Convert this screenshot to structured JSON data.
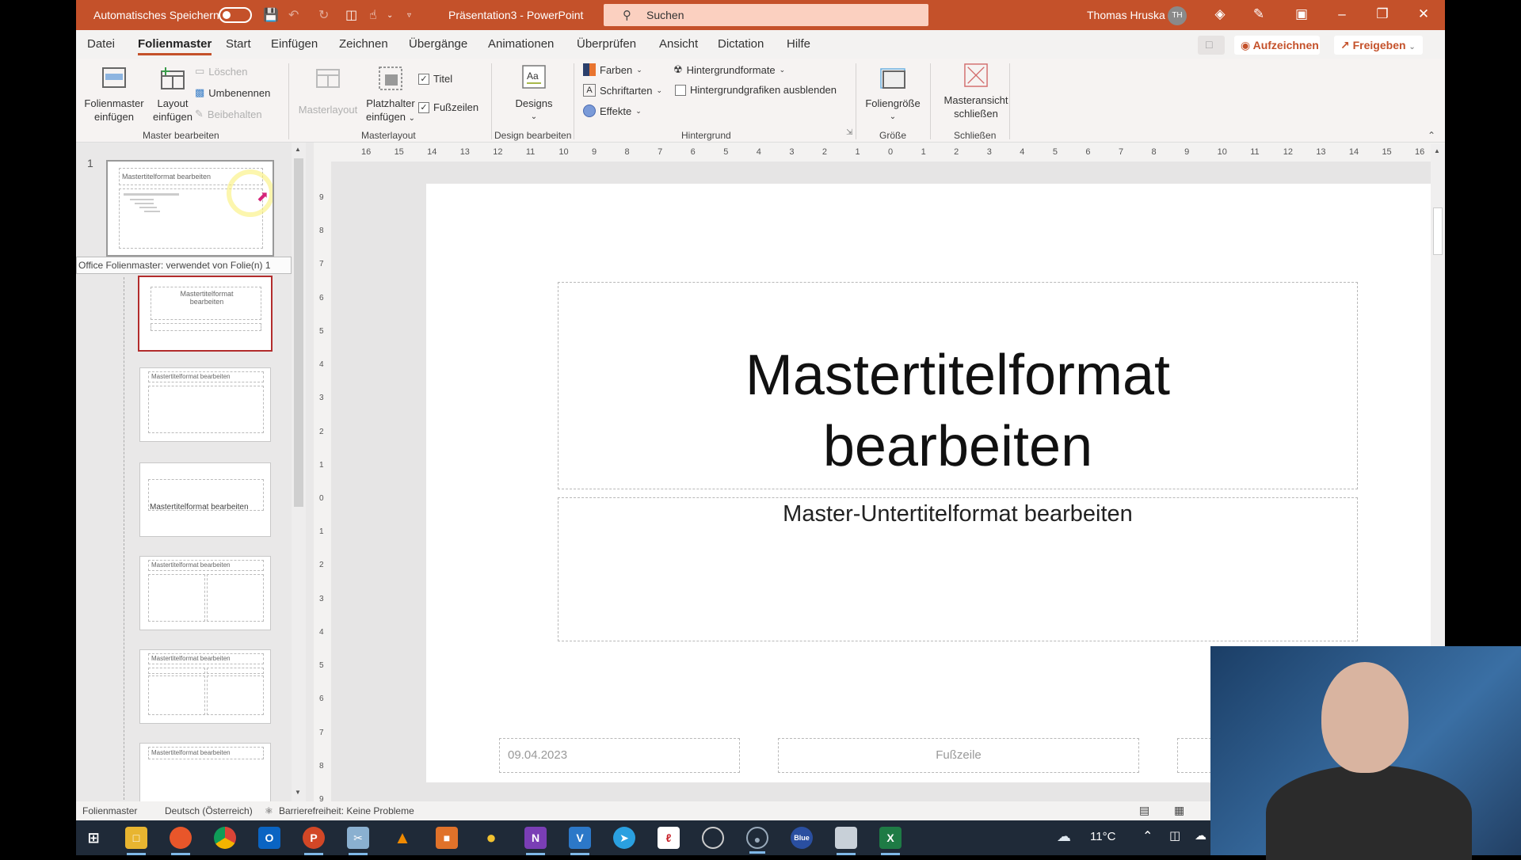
{
  "titlebar": {
    "autosave_label": "Automatisches Speichern",
    "doc_title": "Präsentation3  -  PowerPoint",
    "search_placeholder": "Suchen",
    "user_name": "Thomas Hruska",
    "user_initials": "TH"
  },
  "menu": {
    "tabs": [
      "Datei",
      "Folienmaster",
      "Start",
      "Einfügen",
      "Zeichnen",
      "Übergänge",
      "Animationen",
      "Überprüfen",
      "Ansicht",
      "Dictation",
      "Hilfe"
    ],
    "active": "Folienmaster",
    "record_label": "Aufzeichnen",
    "share_label": "Freigeben"
  },
  "ribbon": {
    "master_bearbeiten": {
      "label": "Master bearbeiten",
      "insert_master": [
        "Folienmaster",
        "einfügen"
      ],
      "insert_layout": [
        "Layout",
        "einfügen"
      ],
      "delete": "Löschen",
      "rename": "Umbenennen",
      "preserve": "Beibehalten"
    },
    "masterlayout": {
      "label": "Masterlayout",
      "masterlayout": "Masterlayout",
      "placeholder": [
        "Platzhalter",
        "einfügen"
      ],
      "title_check": "Titel",
      "title_checked": true,
      "footer_check": "Fußzeilen",
      "footer_checked": true
    },
    "design": {
      "label": "Design bearbeiten",
      "designs": "Designs"
    },
    "hintergrund": {
      "label": "Hintergrund",
      "colors": "Farben",
      "fonts": "Schriftarten",
      "effects": "Effekte",
      "bg_formats": "Hintergrundformate",
      "hide_bg": "Hintergrundgrafiken ausblenden",
      "hide_bg_checked": false
    },
    "groesse": {
      "label": "Größe",
      "slide_size": "Foliengröße"
    },
    "schliessen": {
      "label": "Schließen",
      "close_master": [
        "Masteransicht",
        "schließen"
      ]
    }
  },
  "thumbnails": {
    "master_number": "1",
    "tooltip": "Office Folienmaster: verwendet von Folie(n) 1",
    "master_title": "Mastertitelformat bearbeiten",
    "layouts": [
      {
        "title": "Mastertitelformat bearbeiten",
        "type": "title",
        "selected": true
      },
      {
        "title": "Mastertitelformat bearbeiten",
        "type": "content",
        "selected": false
      },
      {
        "title": "Mastertitelformat bearbeiten",
        "type": "section",
        "selected": false
      },
      {
        "title": "Mastertitelformat bearbeiten",
        "type": "two-content",
        "selected": false
      },
      {
        "title": "Mastertitelformat bearbeiten",
        "type": "comparison",
        "selected": false
      },
      {
        "title": "Mastertitelformat bearbeiten",
        "type": "title-only",
        "selected": false
      }
    ]
  },
  "ruler": {
    "h_ticks": [
      "16",
      "15",
      "14",
      "13",
      "12",
      "11",
      "10",
      "9",
      "8",
      "7",
      "6",
      "5",
      "4",
      "3",
      "2",
      "1",
      "0",
      "1",
      "2",
      "3",
      "4",
      "5",
      "6",
      "7",
      "8",
      "9",
      "10",
      "11",
      "12",
      "13",
      "14",
      "15",
      "16"
    ],
    "v_ticks": [
      "9",
      "8",
      "7",
      "6",
      "5",
      "4",
      "3",
      "2",
      "1",
      "0",
      "1",
      "2",
      "3",
      "4",
      "5",
      "6",
      "7",
      "8",
      "9"
    ]
  },
  "slide": {
    "title_line1": "Mastertitelformat",
    "title_line2": "bearbeiten",
    "subtitle": "Master-Untertitelformat bearbeiten",
    "date": "09.04.2023",
    "footer": "Fußzeile"
  },
  "status": {
    "view": "Folienmaster",
    "language": "Deutsch (Österreich)",
    "accessibility": "Barrierefreiheit: Keine Probleme"
  },
  "taskbar": {
    "apps": [
      "windows-start",
      "file-explorer",
      "firefox",
      "chrome",
      "outlook",
      "powerpoint",
      "snipping-tool",
      "vlc",
      "office",
      "paint",
      "onenote",
      "visio",
      "telegram",
      "acrobat",
      "obs",
      "screen-recorder",
      "blue",
      "scanner",
      "excel"
    ],
    "weather": "11°C"
  }
}
